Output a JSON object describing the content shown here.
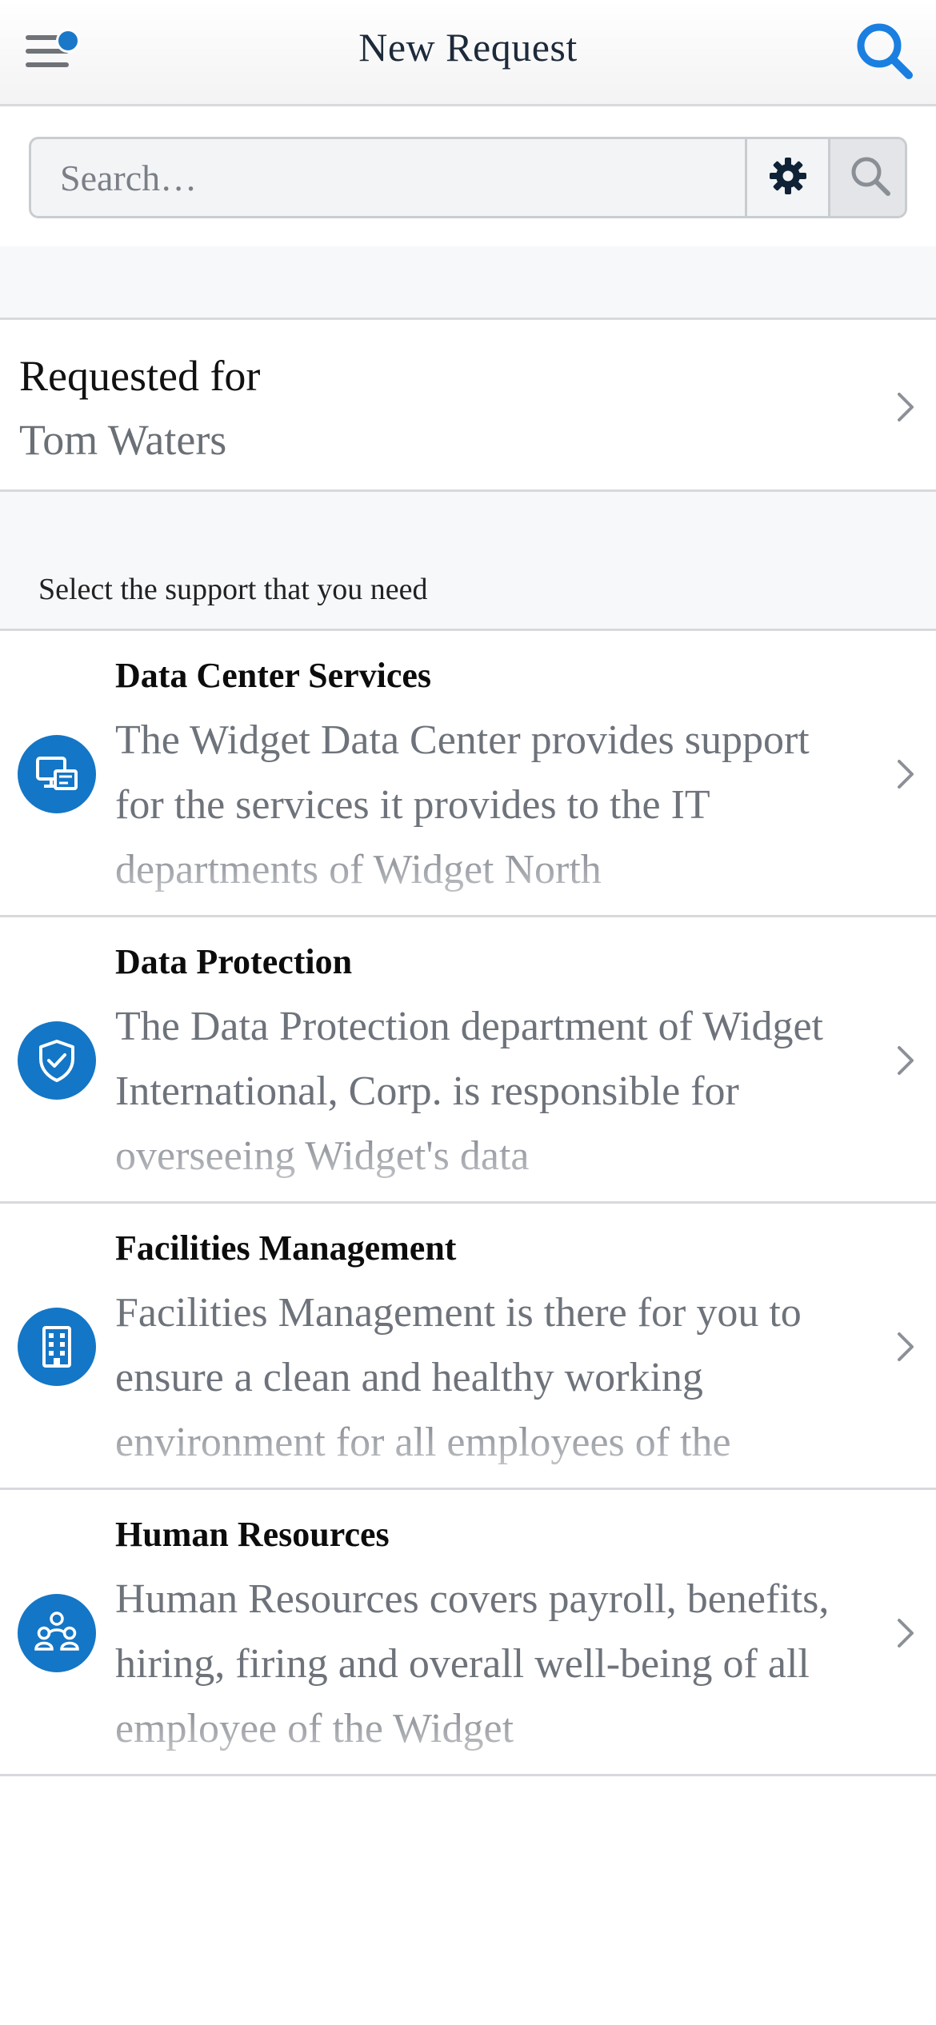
{
  "header": {
    "title": "New Request",
    "menu_icon": "hamburger-menu-icon",
    "notification_dot_color": "#1b78c8",
    "search_icon": "search-icon",
    "accent": "#1a7fe0"
  },
  "search": {
    "placeholder": "Search…",
    "settings_icon": "gear-icon",
    "submit_icon": "search-icon"
  },
  "requested_for": {
    "label": "Requested for",
    "value": "Tom Waters"
  },
  "section": {
    "title": "Select the support that you need"
  },
  "items": [
    {
      "title": "Data Center Services",
      "description": "The Widget Data Center provides support for the services it provides to the IT departments of Widget North",
      "icon": "data-center-icon"
    },
    {
      "title": "Data Protection",
      "description": "The Data Protection department of Widget International, Corp. is responsible for overseeing Widget's data",
      "icon": "shield-check-icon"
    },
    {
      "title": "Facilities Management",
      "description": "Facilities Management is there for you to ensure a clean and healthy working environment for all employees of the",
      "icon": "building-icon"
    },
    {
      "title": "Human Resources",
      "description": "Human Resources covers payroll, benefits, hiring, firing and overall well-being of all employee of the Widget",
      "icon": "people-group-icon"
    }
  ],
  "colors": {
    "icon_background": "#1476c6",
    "divider": "#d7d9dc",
    "muted_text": "#6e737b"
  }
}
